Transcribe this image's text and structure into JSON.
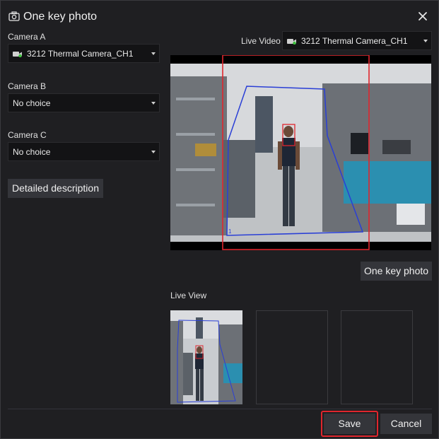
{
  "dialog": {
    "title": "One key photo"
  },
  "camera_a": {
    "label": "Camera A",
    "value": "3212 Thermal Camera_CH1"
  },
  "camera_b": {
    "label": "Camera B",
    "value": "No choice"
  },
  "camera_c": {
    "label": "Camera C",
    "value": "No choice"
  },
  "detailed_description_label": "Detailed description",
  "live_video": {
    "label": "Live Video",
    "value": "3212 Thermal Camera_CH1"
  },
  "overlay": {
    "region_label": "1"
  },
  "one_key_photo_label": "One key photo",
  "live_view_label": "Live View",
  "footer": {
    "save_label": "Save",
    "cancel_label": "Cancel"
  },
  "icons": [
    "camera-icon",
    "close-icon",
    "camera-device-icon",
    "chevron-down-icon"
  ],
  "colors": {
    "background": "#1f1f22",
    "field": "#131315",
    "button": "#34353a",
    "detection_box": "#e0262d",
    "region_line": "#2a3fd6",
    "camera_status": "#3ec23e",
    "highlight_border": "#e0262d"
  }
}
